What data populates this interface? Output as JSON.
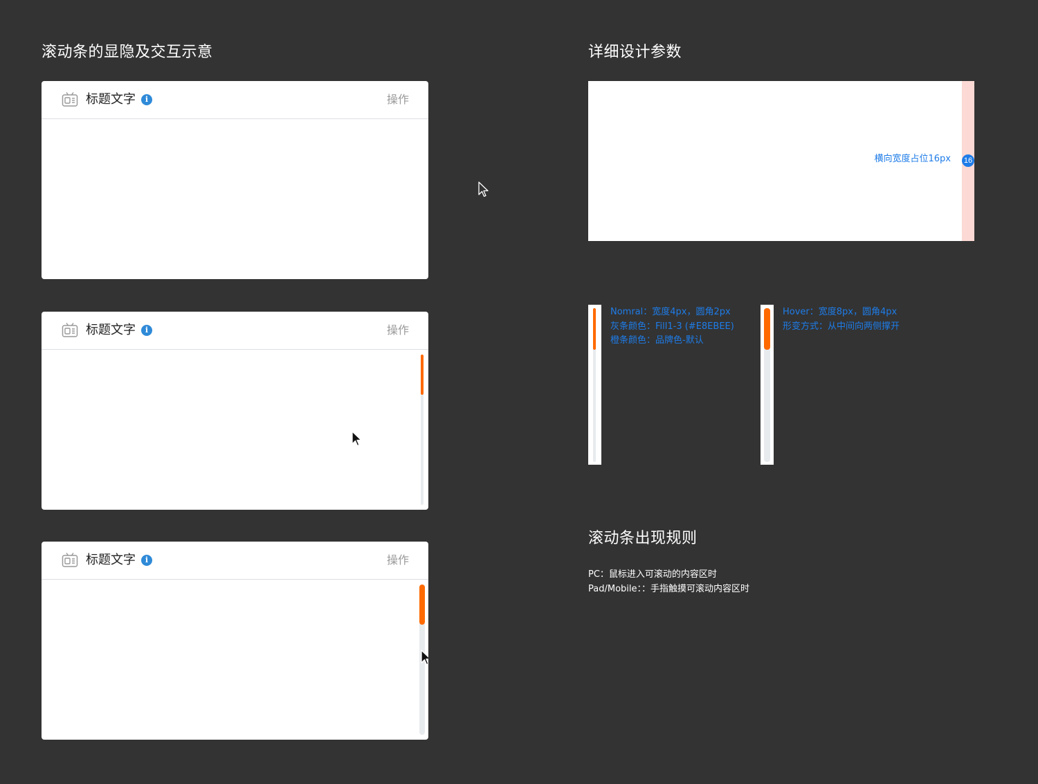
{
  "left_section": {
    "title": "滚动条的显隐及交互示意"
  },
  "cards": [
    {
      "title": "标题文字",
      "info_glyph": "i",
      "action": "操作",
      "icon": "tv-icon"
    },
    {
      "title": "标题文字",
      "info_glyph": "i",
      "action": "操作",
      "icon": "tv-icon"
    },
    {
      "title": "标题文字",
      "info_glyph": "i",
      "action": "操作",
      "icon": "tv-icon"
    }
  ],
  "spec_section": {
    "title": "详细设计参数",
    "width_label": "横向宽度占位16px",
    "width_badge": "16"
  },
  "normal_note": {
    "line1": "Nomral：宽度4px，圆角2px",
    "line2": "灰条颜色：Fill1-3 (#E8EBEE)",
    "line3": "橙条颜色：品牌色-默认"
  },
  "hover_note": {
    "line1": "Hover：宽度8px，圆角4px",
    "line2": "形变方式：从中间向两侧撑开"
  },
  "rules_section": {
    "title": "滚动条出现规则",
    "pc": "PC：鼠标进入可滚动的内容区时",
    "pad": "Pad/Mobile：：手指触摸可滚动内容区时"
  },
  "colors": {
    "background": "#333333",
    "brand_orange": "#FF6A00",
    "track_gray": "#E8EBEE",
    "annotation_blue": "#1E7CE8",
    "spec_pink": "#FCD9D4",
    "info_blue": "#2F8AD8"
  }
}
